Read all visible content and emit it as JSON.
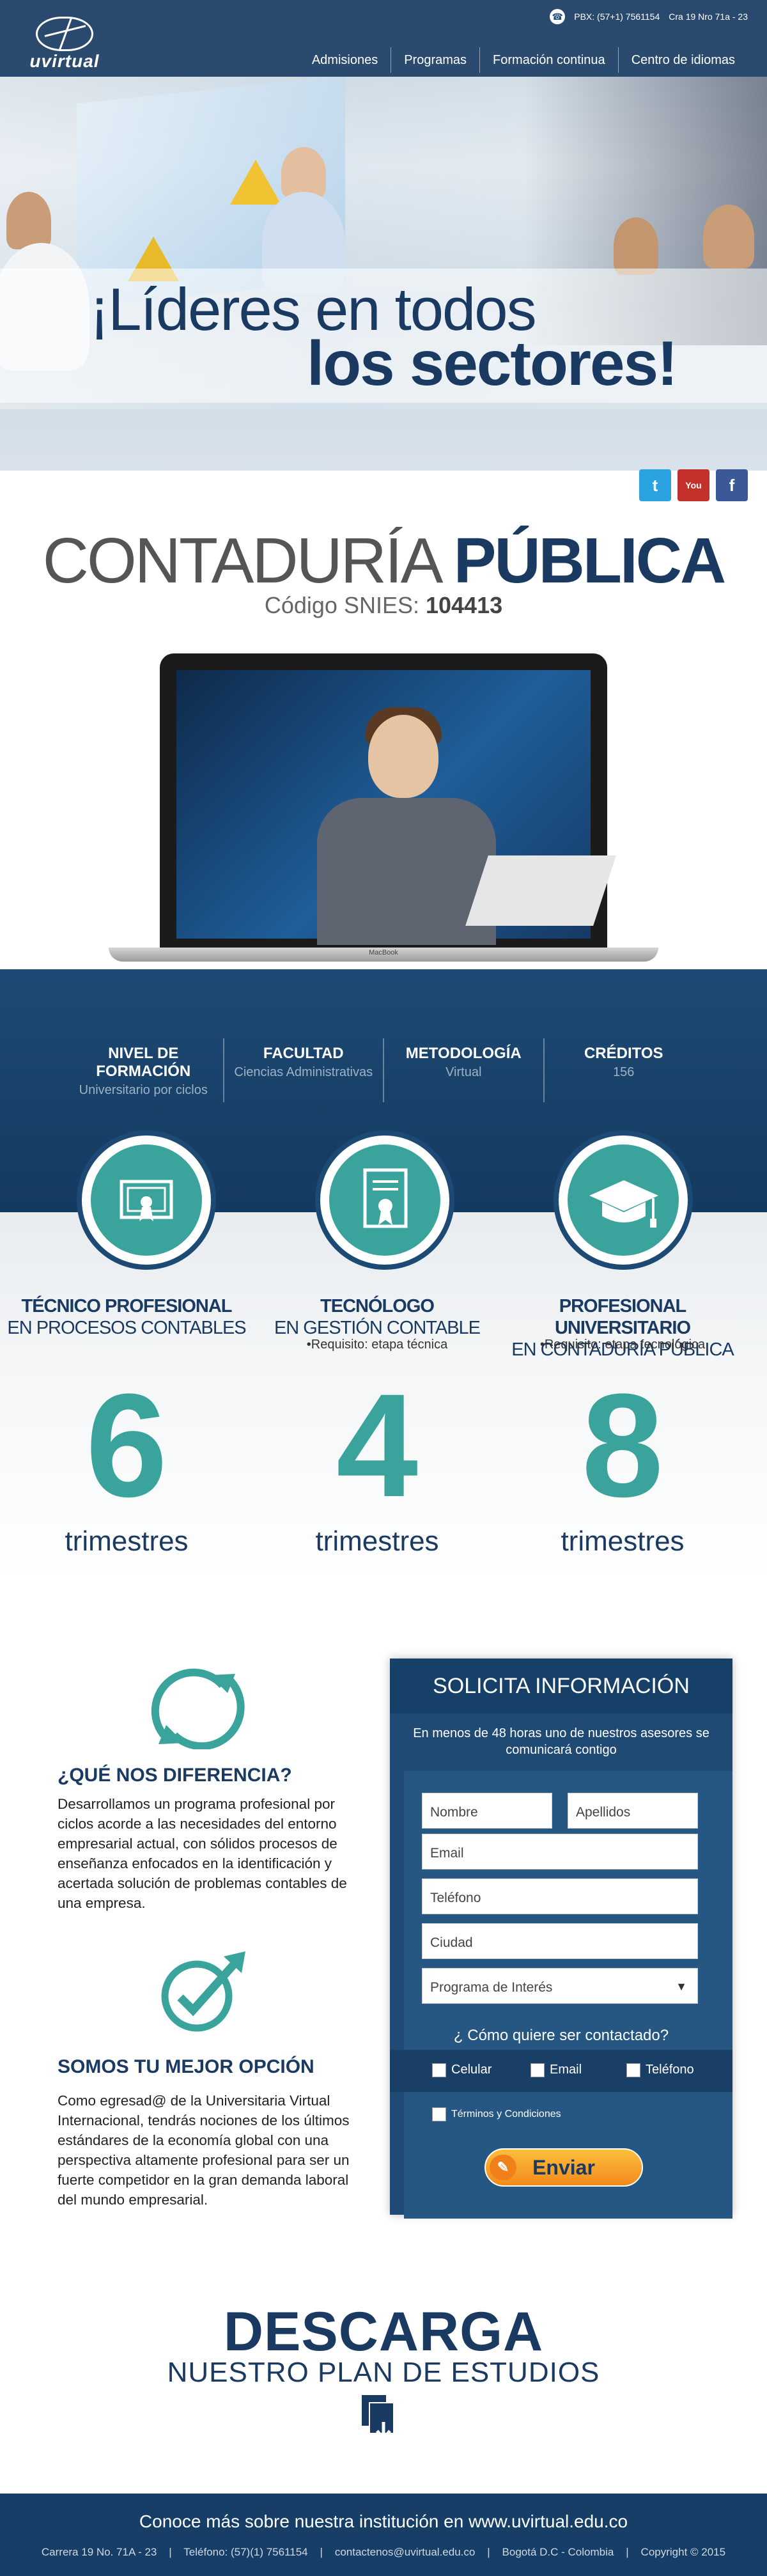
{
  "header": {
    "logo_text": "uvirtual",
    "phone": "PBX: (57+1) 7561154",
    "address": "Cra 19 Nro 71a - 23",
    "nav": [
      "Admisiones",
      "Programas",
      "Formación continua",
      "Centro de idiomas"
    ]
  },
  "hero": {
    "slogan_line1": "¡Líderes en todos",
    "slogan_line2": "los sectores!"
  },
  "social": [
    "twitter",
    "YouTube",
    "facebook"
  ],
  "program": {
    "title_light": "CONTADURÍA ",
    "title_bold": "PÚBLICA",
    "snies_label": "Código SNIES: ",
    "snies_code": "104413",
    "laptop_brand": "MacBook"
  },
  "info": [
    {
      "label": "NIVEL DE FORMACIÓN",
      "value": "Universitario por ciclos"
    },
    {
      "label": "FACULTAD",
      "value": "Ciencias Administrativas"
    },
    {
      "label": "METODOLOGÍA",
      "value": "Virtual"
    },
    {
      "label": "CRÉDITOS",
      "value": "156"
    }
  ],
  "levels": [
    {
      "title1": "TÉCNICO PROFESIONAL",
      "title2": "EN PROCESOS CONTABLES",
      "req": "",
      "number": "6",
      "unit": "trimestres",
      "icon": "certificate-icon"
    },
    {
      "title1": "TECNÓLOGO",
      "title2": "EN GESTIÓN CONTABLE",
      "req": "•Requisito: etapa técnica",
      "number": "4",
      "unit": "trimestres",
      "icon": "diploma-icon"
    },
    {
      "title1": "PROFESIONAL UNIVERSITARIO",
      "title2": "EN CONTADURÍA PÚBLICA",
      "req": "•Requisito: etapa tecnológica",
      "number": "8",
      "unit": "trimestres",
      "icon": "graduation-cap-icon"
    }
  ],
  "features": [
    {
      "heading": "¿QUÉ NOS DIFERENCIA?",
      "text": "Desarrollamos un programa profesional por ciclos acorde a las necesidades del entorno empresarial actual, con sólidos procesos de enseñanza enfocados en la identificación y acertada solución de problemas contables de una empresa."
    },
    {
      "heading": "SOMOS TU MEJOR OPCIÓN",
      "text": "Como egresad@ de la Universitaria Virtual Internacional, tendrás nociones de los últimos estándares de la economía global con una perspectiva altamente profesional para ser un fuerte competidor en la gran demanda laboral del mundo empresarial."
    }
  ],
  "form": {
    "title": "SOLICITA INFORMACIÓN",
    "subtitle": "En menos de 48 horas uno de nuestros asesores se comunicará contigo",
    "fields": {
      "nombre": "Nombre",
      "apellidos": "Apellidos",
      "email": "Email",
      "telefono": "Teléfono",
      "ciudad": "Ciudad",
      "programa": "Programa de Interés"
    },
    "question": "¿ Cómo quiere ser contactado?",
    "contact_options": [
      "Celular",
      "Email",
      "Teléfono"
    ],
    "terms": "Términos y Condiciones",
    "submit": "Enviar"
  },
  "download": {
    "title": "DESCARGA",
    "subtitle": "NUESTRO PLAN DE ESTUDIOS"
  },
  "footer": {
    "main": "Conoce más sobre nuestra institución en www.uvirtual.edu.co",
    "details": "Carrera 19 No. 71A - 23    |    Teléfono: (57)(1) 7561154    |    contactenos@uvirtual.edu.co    |    Bogotá D.C - Colombia    |    Copyright © 2015"
  },
  "colors": {
    "navy": "#1a3a62",
    "teal": "#3aa39b",
    "orange": "#f08a1c"
  }
}
